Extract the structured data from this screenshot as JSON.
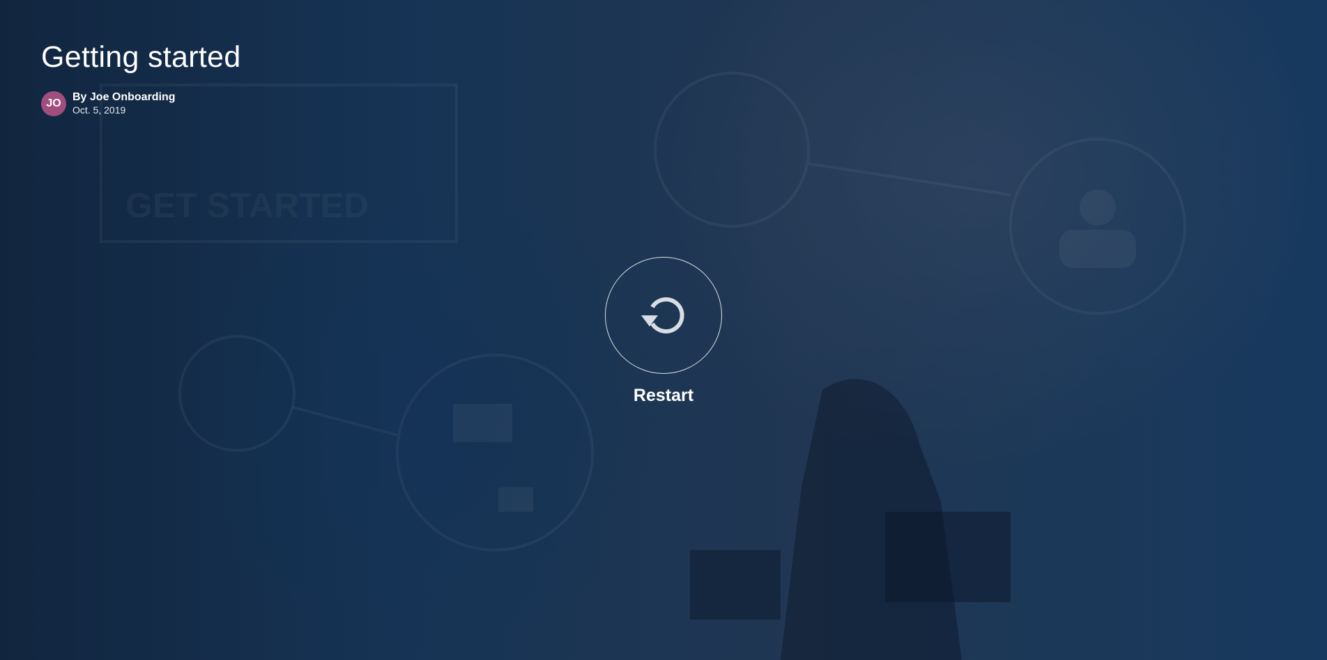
{
  "lesson": {
    "title": "Getting started",
    "author_initials": "JO",
    "author_line": "By Joe Onboarding",
    "date": "Oct. 5, 2019"
  },
  "player": {
    "restart_label": "Restart",
    "restart_icon": "restart-icon"
  },
  "background": {
    "faint_text": [
      "GET STARTED"
    ]
  },
  "colors": {
    "avatar": "#a14e7e",
    "background": "#1c3350"
  }
}
